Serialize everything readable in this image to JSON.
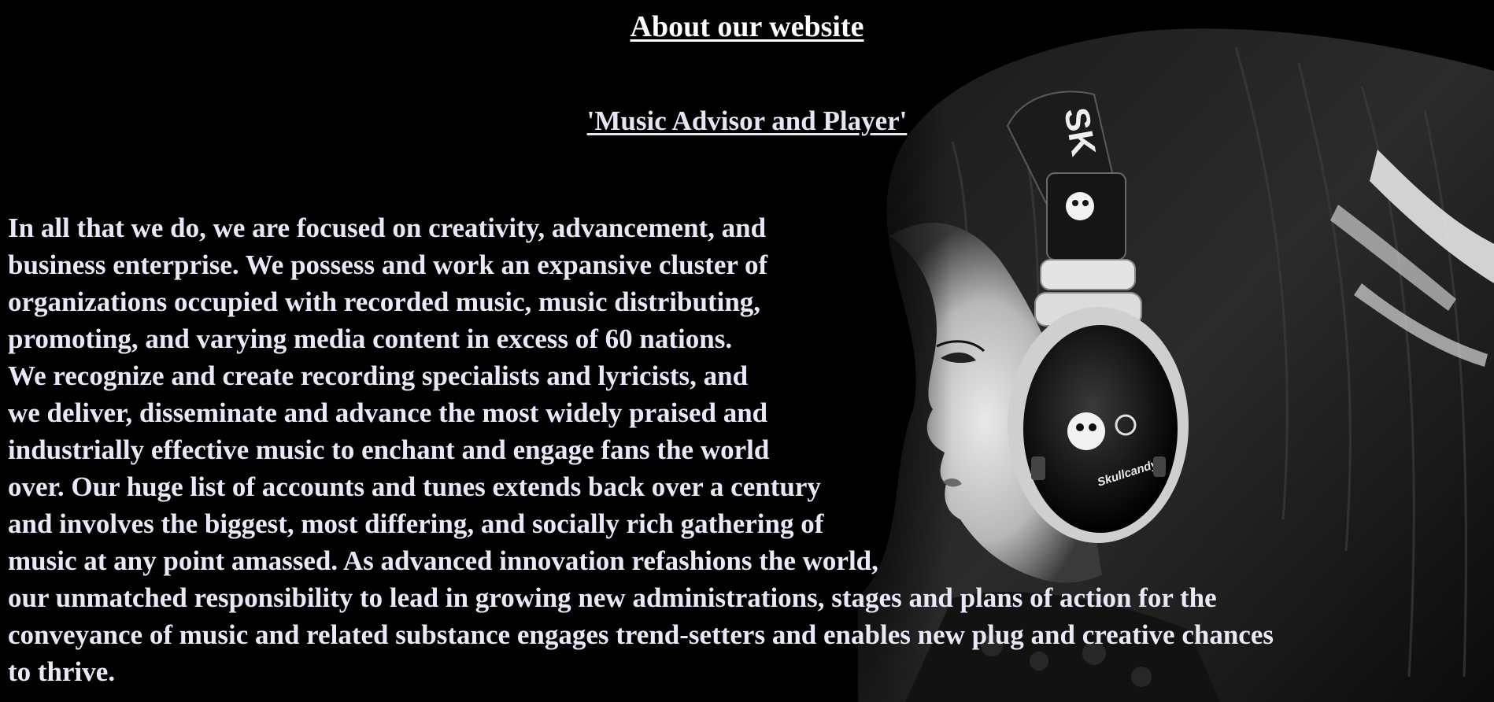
{
  "page": {
    "title": "About our website",
    "subtitle": "'Music Advisor and Player'",
    "body_lines": [
      "In all that we do, we are focused on creativity, advancement, and",
      "business enterprise. We possess and work an expansive cluster of",
      "organizations occupied with recorded music, music distributing,",
      "promoting, and varying media content in excess of 60 nations.",
      "We recognize and create recording specialists and lyricists, and",
      "we deliver, disseminate and advance the most widely praised and",
      "industrially effective music to enchant and engage fans the world",
      "over. Our huge list of accounts and tunes extends back over a century",
      "and involves the biggest, most differing, and socially rich gathering of",
      "music at any point amassed. As advanced innovation refashions the world,",
      "our unmatched responsibility to lead in growing new administrations, stages and plans of action for the",
      "conveyance of music and related substance engages trend-setters and enables new plug and creative chances",
      "to thrive."
    ],
    "headphone_brand": "Skullcandy",
    "headband_text": "SK"
  },
  "colors": {
    "background": "#000000",
    "text": "#ebe7f6",
    "title": "#ffffff"
  }
}
